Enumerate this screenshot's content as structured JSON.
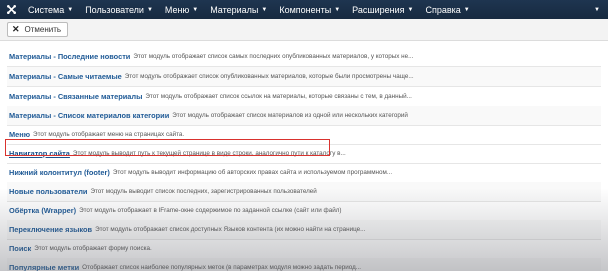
{
  "navbar": {
    "menu": [
      {
        "label": "Система"
      },
      {
        "label": "Пользователи"
      },
      {
        "label": "Меню"
      },
      {
        "label": "Материалы"
      },
      {
        "label": "Компоненты"
      },
      {
        "label": "Расширения"
      },
      {
        "label": "Справка"
      }
    ]
  },
  "toolbar": {
    "cancel_label": "Отменить"
  },
  "modules": [
    {
      "name": "Материалы - Последние новости",
      "desc": "Этот модуль отображает список самых последних опубликованных материалов, у которых не..."
    },
    {
      "name": "Материалы - Самые читаемые",
      "desc": "Этот модуль отображает список опубликованных материалов, которые были просмотрены чаще..."
    },
    {
      "name": "Материалы - Связанные материалы",
      "desc": "Этот модуль отображает список ссылок на материалы, которые связаны с тем, в данный..."
    },
    {
      "name": "Материалы - Список материалов категории",
      "desc": "Этот модуль отображает список материалов из одной или нескольких категорий"
    },
    {
      "name": "Меню",
      "desc": "Этот модуль отображает меню на страницах сайта."
    },
    {
      "name": "Навигатор сайта",
      "desc": "Этот модуль выводит путь к текущей странице в виде строки, аналогично пути к каталогу в..."
    },
    {
      "name": "Нижний колонтитул (footer)",
      "desc": "Этот модуль выводит информацию об авторских правах сайта и используемом программном..."
    },
    {
      "name": "Новые пользователи",
      "desc": "Этот модуль выводит список последних, зарегистрированных пользователей"
    },
    {
      "name": "Обёртка (Wrapper)",
      "desc": "Этот модуль отображает в IFrame-окне содержимое по заданной ссылке (сайт или файл)"
    },
    {
      "name": "Переключение языков",
      "desc": "Этот модуль отображает список доступных Языков контента (их можно найти на странице..."
    },
    {
      "name": "Поиск",
      "desc": "Этот модуль отображает форму поиска."
    },
    {
      "name": "Популярные метки",
      "desc": "Отображает список наиболее популярных меток (в параметрах модуля можно задать период..."
    }
  ],
  "colors": {
    "navbar": "#1e3550",
    "link": "#1f5a96",
    "highlight_border": "#d9322e"
  }
}
